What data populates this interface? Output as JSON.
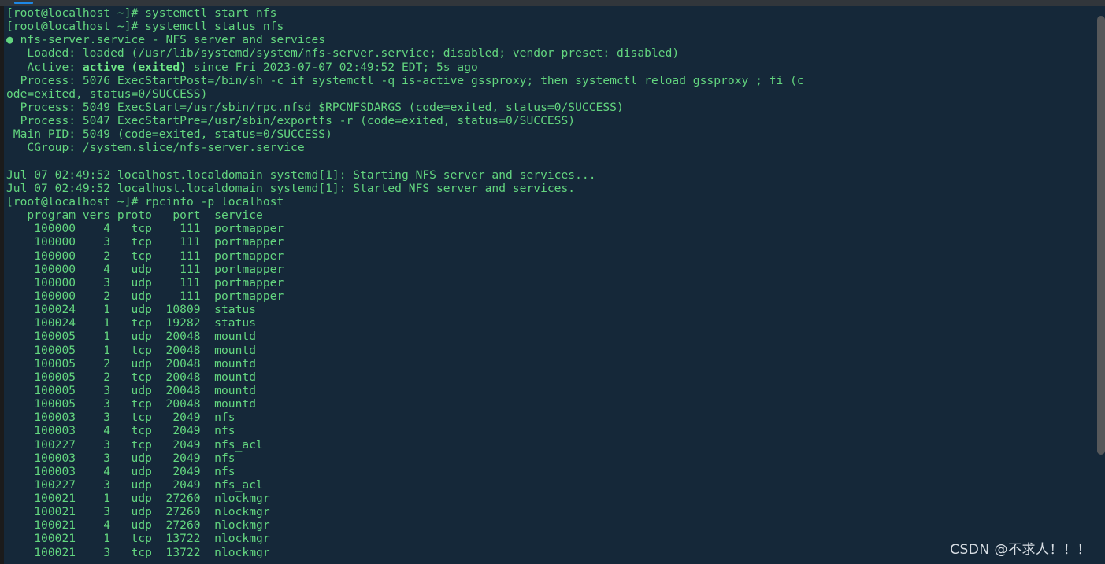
{
  "window": {
    "title_bar_color": "#31363b",
    "tab_indicator_color": "#1e88e5",
    "terminal_bg": "#152839",
    "terminal_fg": "#63d67f"
  },
  "terminal": {
    "prompt": "[root@localhost ~]#",
    "lines": [
      {
        "id": "cmd-start-nfs",
        "text": "[root@localhost ~]# systemctl start nfs"
      },
      {
        "id": "cmd-status-nfs",
        "text": "[root@localhost ~]# systemctl status nfs"
      },
      {
        "id": "svc-header",
        "text": "● nfs-server.service - NFS server and services"
      },
      {
        "id": "svc-loaded",
        "text": "   Loaded: loaded (/usr/lib/systemd/system/nfs-server.service; disabled; vendor preset: disabled)"
      },
      {
        "id": "svc-active",
        "text": "   Active: ",
        "bold": "active (exited)",
        "tail": " since Fri 2023-07-07 02:49:52 EDT; 5s ago"
      },
      {
        "id": "svc-process-1",
        "text": "  Process: 5076 ExecStartPost=/bin/sh -c if systemctl -q is-active gssproxy; then systemctl reload gssproxy ; fi (c"
      },
      {
        "id": "svc-process-1-wrap",
        "text": "ode=exited, status=0/SUCCESS)"
      },
      {
        "id": "svc-process-2",
        "text": "  Process: 5049 ExecStart=/usr/sbin/rpc.nfsd $RPCNFSDARGS (code=exited, status=0/SUCCESS)"
      },
      {
        "id": "svc-process-3",
        "text": "  Process: 5047 ExecStartPre=/usr/sbin/exportfs -r (code=exited, status=0/SUCCESS)"
      },
      {
        "id": "svc-mainpid",
        "text": " Main PID: 5049 (code=exited, status=0/SUCCESS)"
      },
      {
        "id": "svc-cgroup",
        "text": "   CGroup: /system.slice/nfs-server.service"
      },
      {
        "id": "blank-1",
        "text": ""
      },
      {
        "id": "log-1",
        "text": "Jul 07 02:49:52 localhost.localdomain systemd[1]: Starting NFS server and services..."
      },
      {
        "id": "log-2",
        "text": "Jul 07 02:49:52 localhost.localdomain systemd[1]: Started NFS server and services."
      },
      {
        "id": "cmd-rpcinfo",
        "text": "[root@localhost ~]# rpcinfo -p localhost"
      },
      {
        "id": "rpc-header",
        "text": "   program vers proto   port  service"
      },
      {
        "id": "rpc-r1",
        "text": "    100000    4   tcp    111  portmapper"
      },
      {
        "id": "rpc-r2",
        "text": "    100000    3   tcp    111  portmapper"
      },
      {
        "id": "rpc-r3",
        "text": "    100000    2   tcp    111  portmapper"
      },
      {
        "id": "rpc-r4",
        "text": "    100000    4   udp    111  portmapper"
      },
      {
        "id": "rpc-r5",
        "text": "    100000    3   udp    111  portmapper"
      },
      {
        "id": "rpc-r6",
        "text": "    100000    2   udp    111  portmapper"
      },
      {
        "id": "rpc-r7",
        "text": "    100024    1   udp  10809  status"
      },
      {
        "id": "rpc-r8",
        "text": "    100024    1   tcp  19282  status"
      },
      {
        "id": "rpc-r9",
        "text": "    100005    1   udp  20048  mountd"
      },
      {
        "id": "rpc-r10",
        "text": "    100005    1   tcp  20048  mountd"
      },
      {
        "id": "rpc-r11",
        "text": "    100005    2   udp  20048  mountd"
      },
      {
        "id": "rpc-r12",
        "text": "    100005    2   tcp  20048  mountd"
      },
      {
        "id": "rpc-r13",
        "text": "    100005    3   udp  20048  mountd"
      },
      {
        "id": "rpc-r14",
        "text": "    100005    3   tcp  20048  mountd"
      },
      {
        "id": "rpc-r15",
        "text": "    100003    3   tcp   2049  nfs"
      },
      {
        "id": "rpc-r16",
        "text": "    100003    4   tcp   2049  nfs"
      },
      {
        "id": "rpc-r17",
        "text": "    100227    3   tcp   2049  nfs_acl"
      },
      {
        "id": "rpc-r18",
        "text": "    100003    3   udp   2049  nfs"
      },
      {
        "id": "rpc-r19",
        "text": "    100003    4   udp   2049  nfs"
      },
      {
        "id": "rpc-r20",
        "text": "    100227    3   udp   2049  nfs_acl"
      },
      {
        "id": "rpc-r21",
        "text": "    100021    1   udp  27260  nlockmgr"
      },
      {
        "id": "rpc-r22",
        "text": "    100021    3   udp  27260  nlockmgr"
      },
      {
        "id": "rpc-r23",
        "text": "    100021    4   udp  27260  nlockmgr"
      },
      {
        "id": "rpc-r24",
        "text": "    100021    1   tcp  13722  nlockmgr"
      },
      {
        "id": "rpc-r25",
        "text": "    100021    3   tcp  13722  nlockmgr"
      }
    ]
  },
  "rpcinfo_table": {
    "columns": [
      "program",
      "vers",
      "proto",
      "port",
      "service"
    ],
    "rows": [
      [
        "100000",
        "4",
        "tcp",
        "111",
        "portmapper"
      ],
      [
        "100000",
        "3",
        "tcp",
        "111",
        "portmapper"
      ],
      [
        "100000",
        "2",
        "tcp",
        "111",
        "portmapper"
      ],
      [
        "100000",
        "4",
        "udp",
        "111",
        "portmapper"
      ],
      [
        "100000",
        "3",
        "udp",
        "111",
        "portmapper"
      ],
      [
        "100000",
        "2",
        "udp",
        "111",
        "portmapper"
      ],
      [
        "100024",
        "1",
        "udp",
        "10809",
        "status"
      ],
      [
        "100024",
        "1",
        "tcp",
        "19282",
        "status"
      ],
      [
        "100005",
        "1",
        "udp",
        "20048",
        "mountd"
      ],
      [
        "100005",
        "1",
        "tcp",
        "20048",
        "mountd"
      ],
      [
        "100005",
        "2",
        "udp",
        "20048",
        "mountd"
      ],
      [
        "100005",
        "2",
        "tcp",
        "20048",
        "mountd"
      ],
      [
        "100005",
        "3",
        "udp",
        "20048",
        "mountd"
      ],
      [
        "100005",
        "3",
        "tcp",
        "20048",
        "mountd"
      ],
      [
        "100003",
        "3",
        "tcp",
        "2049",
        "nfs"
      ],
      [
        "100003",
        "4",
        "tcp",
        "2049",
        "nfs"
      ],
      [
        "100227",
        "3",
        "tcp",
        "2049",
        "nfs_acl"
      ],
      [
        "100003",
        "3",
        "udp",
        "2049",
        "nfs"
      ],
      [
        "100003",
        "4",
        "udp",
        "2049",
        "nfs"
      ],
      [
        "100227",
        "3",
        "udp",
        "2049",
        "nfs_acl"
      ],
      [
        "100021",
        "1",
        "udp",
        "27260",
        "nlockmgr"
      ],
      [
        "100021",
        "3",
        "udp",
        "27260",
        "nlockmgr"
      ],
      [
        "100021",
        "4",
        "udp",
        "27260",
        "nlockmgr"
      ],
      [
        "100021",
        "1",
        "tcp",
        "13722",
        "nlockmgr"
      ],
      [
        "100021",
        "3",
        "tcp",
        "13722",
        "nlockmgr"
      ]
    ]
  },
  "watermark": {
    "text": "CSDN @不求人！！！"
  }
}
